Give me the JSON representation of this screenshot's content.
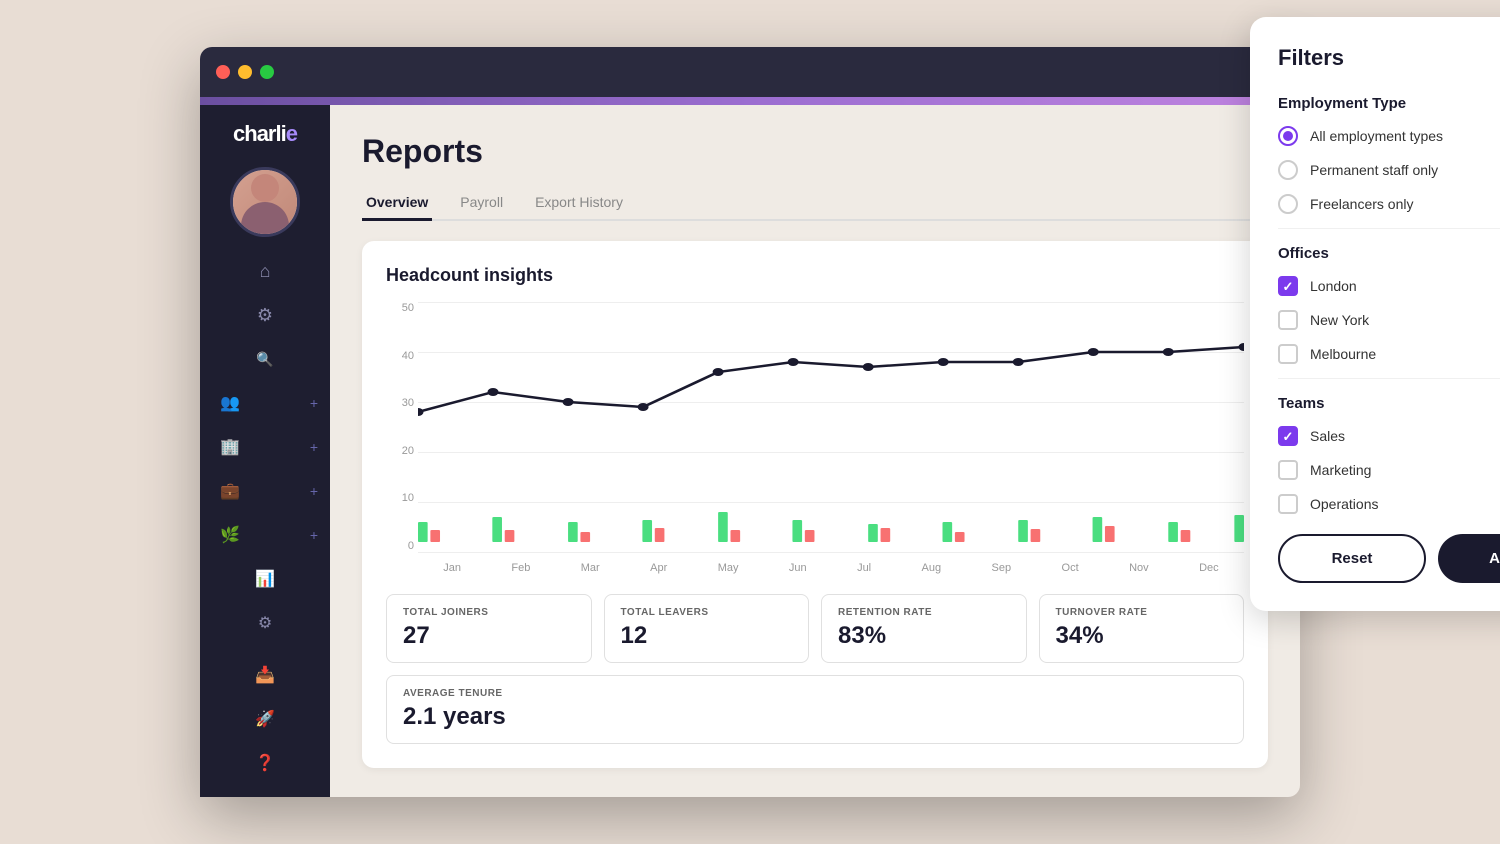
{
  "app": {
    "title": "Charlie HR",
    "logo": "charli",
    "logo_dot": "e"
  },
  "browser": {
    "dots": [
      "red",
      "yellow",
      "green"
    ]
  },
  "sidebar": {
    "icons": [
      {
        "name": "home-icon",
        "symbol": "⌂"
      },
      {
        "name": "settings-icon",
        "symbol": "⚙"
      },
      {
        "name": "search-icon",
        "symbol": "🔍"
      },
      {
        "name": "people-icon",
        "symbol": "👥"
      },
      {
        "name": "building-icon",
        "symbol": "🏢"
      },
      {
        "name": "briefcase-icon",
        "symbol": "💼"
      },
      {
        "name": "leaf-icon",
        "symbol": "🌱"
      },
      {
        "name": "chart-icon",
        "symbol": "📊"
      },
      {
        "name": "gear-icon",
        "symbol": "⚙"
      },
      {
        "name": "inbox-icon",
        "symbol": "📥"
      },
      {
        "name": "rocket-icon",
        "symbol": "🚀"
      },
      {
        "name": "help-icon",
        "symbol": "❓"
      }
    ]
  },
  "page": {
    "title": "Reports",
    "tabs": [
      {
        "label": "Overview",
        "active": true
      },
      {
        "label": "Payroll",
        "active": false
      },
      {
        "label": "Export History",
        "active": false
      }
    ]
  },
  "chart": {
    "title": "Headcount insights",
    "y_labels": [
      "50",
      "40",
      "30",
      "20",
      "10",
      "0"
    ],
    "x_labels": [
      "Jan",
      "Feb",
      "Mar",
      "Apr",
      "May",
      "Jun",
      "Jul",
      "Aug",
      "Sep",
      "Oct",
      "Nov",
      "Dec"
    ],
    "data_points": [
      28,
      32,
      30,
      29,
      36,
      38,
      37,
      38,
      38,
      40,
      40,
      41
    ]
  },
  "stats": {
    "total_joiners_label": "TOTAL JOINERS",
    "total_joiners_value": "27",
    "total_leavers_label": "TOTAL LEAVERS",
    "total_leavers_value": "12",
    "retention_rate_label": "RETENTION RATE",
    "retention_rate_value": "83%",
    "turnover_rate_label": "TURNOVER RATE",
    "turnover_rate_value": "34%",
    "avg_tenure_label": "AVERAGE TENURE",
    "avg_tenure_value": "2.1 years"
  },
  "filters": {
    "title": "Filters",
    "close_label": "×",
    "employment_type_title": "Employment Type",
    "employment_options": [
      {
        "label": "All employment types",
        "selected": true
      },
      {
        "label": "Permanent staff only",
        "selected": false
      },
      {
        "label": "Freelancers only",
        "selected": false
      }
    ],
    "offices_title": "Offices",
    "office_options": [
      {
        "label": "London",
        "checked": true
      },
      {
        "label": "New York",
        "checked": false
      },
      {
        "label": "Melbourne",
        "checked": false
      }
    ],
    "teams_title": "Teams",
    "team_options": [
      {
        "label": "Sales",
        "checked": true
      },
      {
        "label": "Marketing",
        "checked": false
      },
      {
        "label": "Operations",
        "checked": false
      }
    ],
    "reset_label": "Reset",
    "apply_label": "Apply"
  }
}
